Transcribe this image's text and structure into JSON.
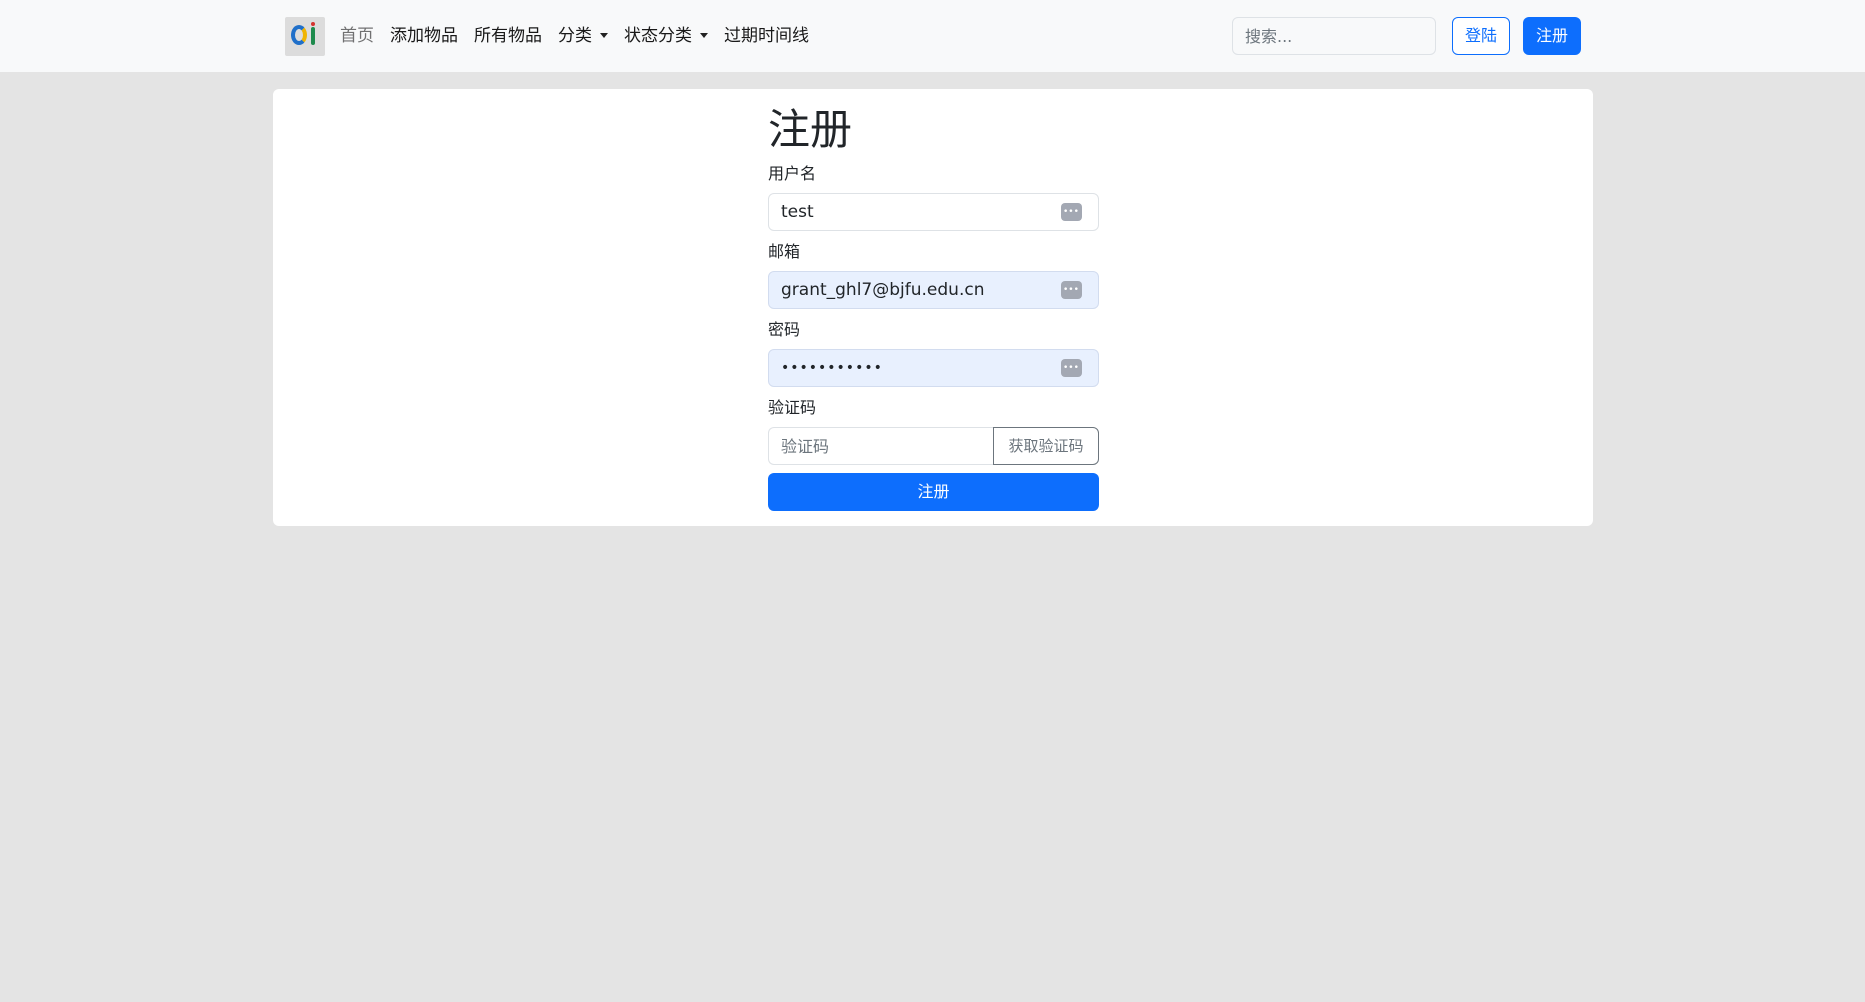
{
  "navbar": {
    "items": [
      {
        "label": "首页"
      },
      {
        "label": "添加物品"
      },
      {
        "label": "所有物品"
      },
      {
        "label": "分类"
      },
      {
        "label": "状态分类"
      },
      {
        "label": "过期时间线"
      }
    ],
    "search_placeholder": "搜索...",
    "login_label": "登陆",
    "register_label": "注册"
  },
  "form": {
    "title": "注册",
    "username": {
      "label": "用户名",
      "value": "test"
    },
    "email": {
      "label": "邮箱",
      "value": "grant_ghl7@bjfu.edu.cn"
    },
    "password": {
      "label": "密码",
      "value": "•••••••••••"
    },
    "captcha": {
      "label": "验证码",
      "placeholder": "验证码",
      "button_label": "获取验证码"
    },
    "submit_label": "注册"
  },
  "icons": {
    "logo": "site-logo-icon",
    "dropdown": "caret-down-icon",
    "password_manager": "password-manager-key-icon"
  },
  "colors": {
    "primary": "#0d6efd",
    "navbar_bg": "#f8f9fa",
    "page_bg": "#e4e4e4",
    "autofill_bg": "#e8f0fe"
  }
}
